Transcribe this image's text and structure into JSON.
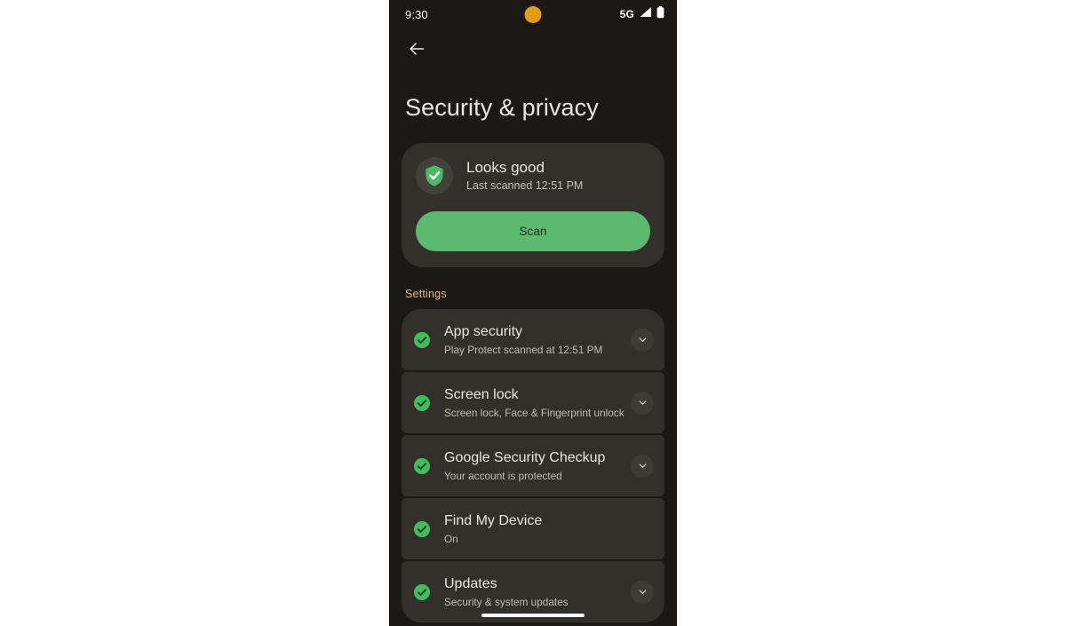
{
  "colors": {
    "screen_bg": "#1b1815",
    "card_bg": "#332f2a",
    "accent_green": "#5cb970",
    "section_label": "#dfb878",
    "title_text": "#eae5de",
    "punch_hole": "#e59a17"
  },
  "status_bar": {
    "time": "9:30",
    "network": "5G",
    "signal_icon": "signal-bars-icon",
    "battery_icon": "battery-full-icon",
    "camera_icon": "camera-punch-hole"
  },
  "app_bar": {
    "back_icon": "arrow-left-icon"
  },
  "header": {
    "title": "Security & privacy"
  },
  "status_card": {
    "shield_icon": "shield-check-icon",
    "headline": "Looks good",
    "subtitle": "Last scanned 12:51 PM",
    "scan_label": "Scan"
  },
  "settings_section": {
    "label": "Settings",
    "items": [
      {
        "title": "App security",
        "subtitle": "Play Protect scanned at 12:51 PM",
        "status_icon": "check-circle-icon",
        "expand_icon": "chevron-down-icon",
        "has_expand": true
      },
      {
        "title": "Screen lock",
        "subtitle": "Screen lock, Face & Fingerprint unlock",
        "status_icon": "check-circle-icon",
        "expand_icon": "chevron-down-icon",
        "has_expand": true
      },
      {
        "title": "Google Security Checkup",
        "subtitle": "Your account is protected",
        "status_icon": "check-circle-icon",
        "expand_icon": "chevron-down-icon",
        "has_expand": true
      },
      {
        "title": "Find My Device",
        "subtitle": "On",
        "status_icon": "check-circle-icon",
        "expand_icon": "",
        "has_expand": false
      },
      {
        "title": "Updates",
        "subtitle": "Security & system updates",
        "status_icon": "check-circle-icon",
        "expand_icon": "chevron-down-icon",
        "has_expand": true
      }
    ]
  },
  "nav": {
    "gesture_handle": "gesture-nav-handle"
  }
}
